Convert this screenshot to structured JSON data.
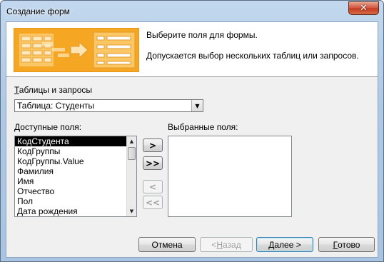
{
  "window": {
    "title": "Создание форм",
    "close_glyph": "✕"
  },
  "banner": {
    "line1": "Выберите поля для формы.",
    "line2": "Допускается выбор нескольких таблиц или запросов."
  },
  "tables": {
    "label_mnemonic": "Т",
    "label_rest": "аблицы и запросы",
    "selected": "Таблица: Студенты",
    "arrow": "▼"
  },
  "available": {
    "label_mnemonic": "Д",
    "label_rest": "оступные поля:",
    "items": [
      "КодСтудента",
      "КодГруппы",
      "КодГруппы.Value",
      "Фамилия",
      "Имя",
      "Отчество",
      "Пол",
      "Дата рождения"
    ],
    "selected_index": 0,
    "scroll_up": "▲",
    "scroll_down": "▼"
  },
  "selected_fields": {
    "label_prefix": "Выбранные поля:",
    "items": []
  },
  "move_buttons": {
    "add_one": ">",
    "add_all": ">>",
    "remove_one": "<",
    "remove_all": "<<"
  },
  "footer": {
    "cancel": "Отмена",
    "back_arrow": "< ",
    "back_mnemonic": "Н",
    "back_rest": "азад",
    "next_mnemonic": "Д",
    "next_rest": "алее >",
    "finish_mnemonic": "Г",
    "finish_rest": "отово"
  },
  "colors": {
    "title_bar": "#aec9e6",
    "close_button": "#c23a1e",
    "dialog_bg": "#f0f0f0",
    "selection": "#000000",
    "illustration_orange": "#f5a623"
  },
  "icons": {
    "close": "close-icon",
    "combo_arrow": "chevron-down-icon"
  }
}
